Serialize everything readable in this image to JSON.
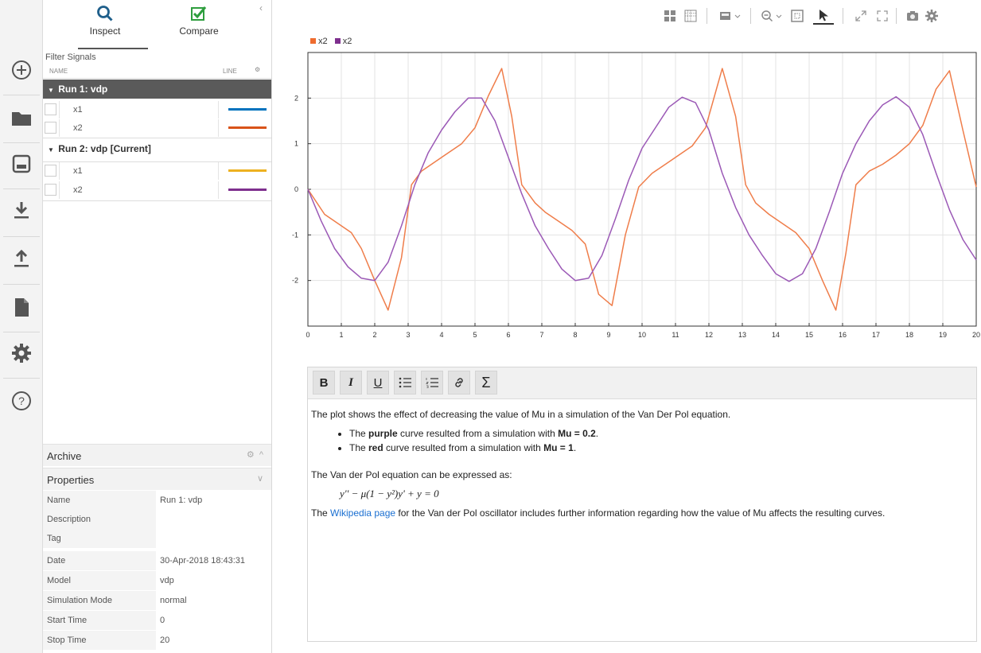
{
  "tabs": {
    "inspect_label": "Inspect",
    "compare_label": "Compare"
  },
  "signals": {
    "filter_label": "Filter Signals",
    "col_name": "NAME",
    "col_line": "LINE",
    "runs": [
      {
        "label": "Run 1: vdp",
        "selected": true,
        "signals": [
          {
            "name": "x1",
            "color": "#0072bd"
          },
          {
            "name": "x2",
            "color": "#d95319"
          }
        ]
      },
      {
        "label": "Run 2: vdp [Current]",
        "selected": false,
        "signals": [
          {
            "name": "x1",
            "color": "#edb120"
          },
          {
            "name": "x2",
            "color": "#7e2f8e"
          }
        ]
      }
    ]
  },
  "archive": {
    "label": "Archive"
  },
  "properties": {
    "label": "Properties",
    "rows": [
      {
        "key": "Name",
        "value": "Run 1: vdp"
      },
      {
        "key": "Description",
        "value": ""
      },
      {
        "key": "Tag",
        "value": ""
      },
      {
        "key": "Date",
        "value": "30-Apr-2018 18:43:31"
      },
      {
        "key": "Model",
        "value": "vdp"
      },
      {
        "key": "Simulation Mode",
        "value": "normal"
      },
      {
        "key": "Start Time",
        "value": "0"
      },
      {
        "key": "Stop Time",
        "value": "20"
      }
    ]
  },
  "legend": [
    {
      "label": "x2",
      "color": "#ef6c2f"
    },
    {
      "label": "x2",
      "color": "#7e2f8e"
    }
  ],
  "chart_data": {
    "type": "line",
    "xlim": [
      0,
      20
    ],
    "ylim": [
      -3,
      3
    ],
    "xticks": [
      0,
      1,
      2,
      3,
      4,
      5,
      6,
      7,
      8,
      9,
      10,
      11,
      12,
      13,
      14,
      15,
      16,
      17,
      18,
      19,
      20
    ],
    "yticks": [
      2,
      1,
      0,
      -1,
      -2
    ],
    "grid": true,
    "series": [
      {
        "name": "x2",
        "color": "#ef7d4a",
        "x": [
          0,
          0.5,
          0.9,
          1.3,
          1.6,
          2.0,
          2.4,
          2.8,
          3.1,
          3.4,
          3.7,
          4.1,
          4.6,
          5.0,
          5.4,
          5.8,
          6.1,
          6.4,
          6.8,
          7.1,
          7.5,
          7.9,
          8.3,
          8.7,
          9.1,
          9.5,
          9.9,
          10.3,
          10.7,
          11.1,
          11.5,
          11.9,
          12.4,
          12.8,
          13.1,
          13.4,
          13.8,
          14.2,
          14.6,
          15.0,
          15.4,
          15.8,
          16.1,
          16.4,
          16.8,
          17.2,
          17.6,
          18.0,
          18.4,
          18.8,
          19.2,
          19.6,
          20.0
        ],
        "y": [
          0,
          -0.55,
          -0.75,
          -0.95,
          -1.3,
          -2.0,
          -2.65,
          -1.5,
          0.1,
          0.4,
          0.55,
          0.75,
          1.0,
          1.35,
          2.05,
          2.65,
          1.6,
          0.1,
          -0.3,
          -0.5,
          -0.7,
          -0.9,
          -1.2,
          -2.3,
          -2.55,
          -1.0,
          0.05,
          0.35,
          0.55,
          0.75,
          0.95,
          1.35,
          2.65,
          1.6,
          0.1,
          -0.3,
          -0.55,
          -0.75,
          -0.95,
          -1.3,
          -2.0,
          -2.65,
          -1.4,
          0.1,
          0.4,
          0.55,
          0.75,
          1.0,
          1.4,
          2.2,
          2.6,
          1.3,
          0.05
        ]
      },
      {
        "name": "x2",
        "color": "#9b59b6",
        "x": [
          0,
          0.4,
          0.8,
          1.2,
          1.6,
          2.0,
          2.4,
          2.8,
          3.2,
          3.6,
          4.0,
          4.4,
          4.8,
          5.2,
          5.6,
          6.0,
          6.4,
          6.8,
          7.2,
          7.6,
          8.0,
          8.4,
          8.8,
          9.2,
          9.6,
          10.0,
          10.4,
          10.8,
          11.2,
          11.6,
          12.0,
          12.4,
          12.8,
          13.2,
          13.6,
          14.0,
          14.4,
          14.8,
          15.2,
          15.6,
          16.0,
          16.4,
          16.8,
          17.2,
          17.6,
          18.0,
          18.4,
          18.8,
          19.2,
          19.6,
          20.0
        ],
        "y": [
          0,
          -0.7,
          -1.3,
          -1.7,
          -1.95,
          -2.0,
          -1.6,
          -0.8,
          0.1,
          0.8,
          1.3,
          1.7,
          2.0,
          2.0,
          1.5,
          0.7,
          -0.1,
          -0.8,
          -1.3,
          -1.75,
          -2.0,
          -1.95,
          -1.45,
          -0.65,
          0.2,
          0.9,
          1.35,
          1.8,
          2.02,
          1.9,
          1.3,
          0.35,
          -0.4,
          -1.0,
          -1.45,
          -1.85,
          -2.02,
          -1.85,
          -1.3,
          -0.5,
          0.35,
          1.0,
          1.5,
          1.85,
          2.03,
          1.8,
          1.2,
          0.35,
          -0.45,
          -1.1,
          -1.55
        ]
      }
    ]
  },
  "editor": {
    "toolbar": [
      "B",
      "I",
      "U",
      "bullets",
      "numbered",
      "link",
      "Σ"
    ],
    "intro": "The plot shows the effect of decreasing the value of Mu in a simulation of the Van Der Pol equation.",
    "bullet1_pre": "The ",
    "bullet1_bold": "purple",
    "bullet1_mid": " curve resulted from a simulation with ",
    "bullet1_val": "Mu = 0.2",
    "bullet1_end": ".",
    "bullet2_pre": "The ",
    "bullet2_bold": "red",
    "bullet2_mid": " curve resulted from a simulation with ",
    "bullet2_val": "Mu = 1",
    "bullet2_end": ".",
    "expr_text": "The Van der Pol equation can be expressed as:",
    "equation": "y'' − μ(1 − y²)y' + y = 0",
    "para_pre": "The ",
    "link_text": "Wikipedia page",
    "para_post": " for the Van der Pol oscillator includes further information regarding how the value of Mu affects the resulting curves."
  }
}
